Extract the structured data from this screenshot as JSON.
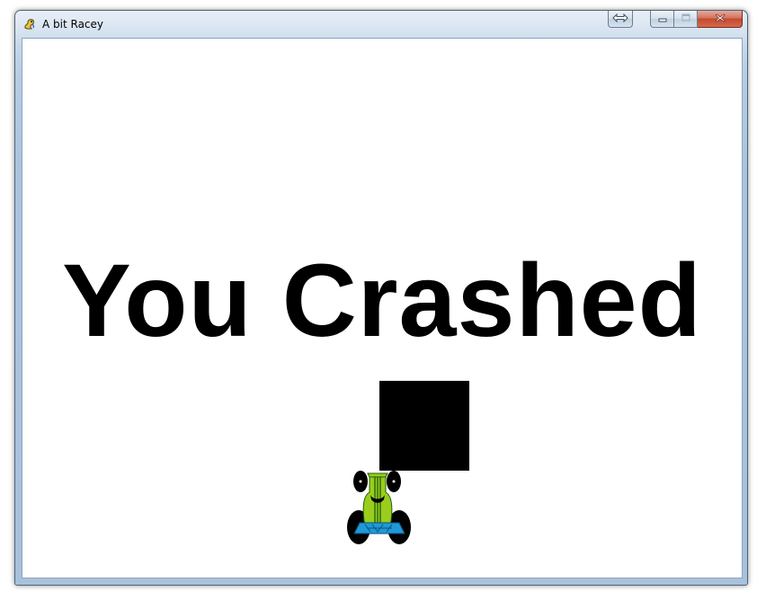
{
  "window": {
    "title": "A bit Racey",
    "icon": "pygame-snake-icon"
  },
  "caption_buttons": {
    "switch_icon": "double-arrow-icon",
    "minimize_icon": "minimize-icon",
    "maximize_icon": "maximize-icon",
    "close_icon": "close-icon"
  },
  "game": {
    "message": "You Crashed",
    "background_color": "#ffffff",
    "text_color": "#000000",
    "obstacle_color": "#000000",
    "car": {
      "body_color": "#9acd1c",
      "stripe_color": "#1f5d0c",
      "wheel_color": "#000000",
      "spoiler_color": "#1e9ad6"
    }
  }
}
